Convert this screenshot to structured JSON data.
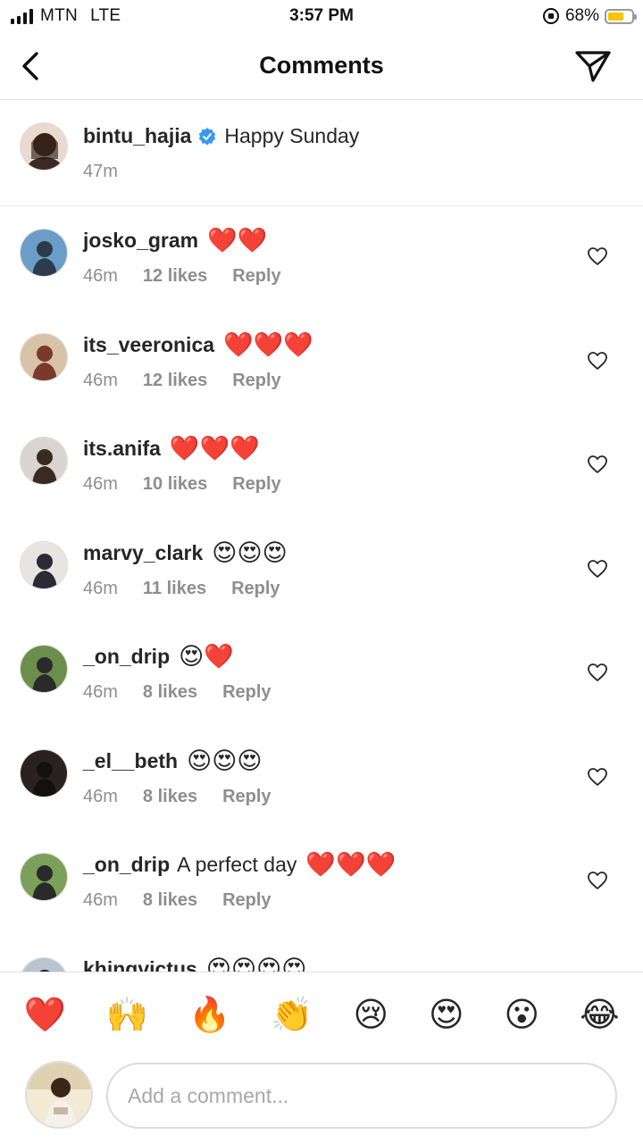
{
  "status_bar": {
    "carrier": "MTN",
    "network": "LTE",
    "time": "3:57 PM",
    "battery": "68%",
    "battery_level": 0.68
  },
  "header": {
    "title": "Comments",
    "back_icon": "chevron-left-icon",
    "share_icon": "paper-plane-icon"
  },
  "caption": {
    "username": "bintu_hajia",
    "verified": true,
    "text": "Happy Sunday",
    "time": "47m"
  },
  "comments": [
    {
      "username": "josko_gram",
      "text": "",
      "emojis": "❤️❤️",
      "time": "46m",
      "likes": "12 likes",
      "reply": "Reply"
    },
    {
      "username": "its_veeronica",
      "text": "",
      "emojis": "❤️❤️❤️",
      "time": "46m",
      "likes": "12 likes",
      "reply": "Reply"
    },
    {
      "username": "its.anifa",
      "text": "",
      "emojis": "❤️❤️❤️",
      "time": "46m",
      "likes": "10 likes",
      "reply": "Reply"
    },
    {
      "username": "marvy_clark",
      "text": "",
      "emojis": "😍😍😍",
      "time": "46m",
      "likes": "11 likes",
      "reply": "Reply"
    },
    {
      "username": "_on_drip",
      "text": "",
      "emojis": "😍❤️",
      "time": "46m",
      "likes": "8 likes",
      "reply": "Reply"
    },
    {
      "username": "_el__beth",
      "text": "",
      "emojis": "😍😍😍",
      "time": "46m",
      "likes": "8 likes",
      "reply": "Reply"
    },
    {
      "username": "_on_drip",
      "text": "A perfect day",
      "emojis": "❤️❤️❤️",
      "time": "46m",
      "likes": "8 likes",
      "reply": "Reply"
    },
    {
      "username": "khingvictus",
      "text": "",
      "emojis": "😍😍😍😍",
      "time": "",
      "likes": "",
      "reply": ""
    }
  ],
  "reactions": [
    "❤️",
    "🙌",
    "🔥",
    "👏",
    "😢",
    "😍",
    "😮",
    "😂"
  ],
  "input": {
    "placeholder": "Add a comment..."
  },
  "colors": {
    "accent_verified": "#3897f0",
    "muted": "#8e8e8e",
    "text": "#262626"
  }
}
